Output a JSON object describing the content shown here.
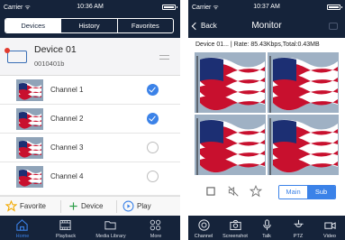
{
  "left_phone": {
    "status_bar": {
      "carrier": "Carrier ᯤ",
      "time": "10:36 AM"
    },
    "tabs": [
      {
        "label": "Devices",
        "active": true
      },
      {
        "label": "History",
        "active": false
      },
      {
        "label": "Favorites",
        "active": false
      }
    ],
    "device": {
      "name": "Device 01",
      "id": "0010401b",
      "icon": "dvr-device-icon"
    },
    "channels": [
      {
        "label": "Channel 1",
        "checked": true
      },
      {
        "label": "Channel 2",
        "checked": true
      },
      {
        "label": "Channel 3",
        "checked": false
      },
      {
        "label": "Channel 4",
        "checked": false
      }
    ],
    "actions": {
      "favorite": "Favorite",
      "device": "Device",
      "play": "Play"
    },
    "bottom_tabs": [
      {
        "label": "Home",
        "icon": "home-icon",
        "active": true
      },
      {
        "label": "Playback",
        "icon": "film-icon",
        "active": false
      },
      {
        "label": "Media Library",
        "icon": "folder-icon",
        "active": false
      },
      {
        "label": "More",
        "icon": "grid-icon",
        "active": false
      }
    ]
  },
  "right_phone": {
    "status_bar": {
      "carrier": "Carrier ᯤ",
      "time": "10:37 AM"
    },
    "nav": {
      "back_label": "Back",
      "title": "Monitor"
    },
    "info_line": "Device 01... | Rate: 85.43Kbps,Total:0.43MB",
    "stream": {
      "main_label": "Main",
      "sub_label": "Sub",
      "selected": "Sub"
    },
    "bottom_tabs": [
      {
        "label": "Channel",
        "icon": "channel-icon"
      },
      {
        "label": "Screenshot",
        "icon": "camera-icon"
      },
      {
        "label": "Talk",
        "icon": "microphone-icon"
      },
      {
        "label": "PTZ",
        "icon": "ptz-icon"
      },
      {
        "label": "Video",
        "icon": "video-camera-icon"
      }
    ]
  },
  "colors": {
    "nav_dark": "#15233a",
    "accent_blue": "#3b82e8",
    "flag_red": "#c8102e",
    "flag_blue": "#1c2f73"
  }
}
